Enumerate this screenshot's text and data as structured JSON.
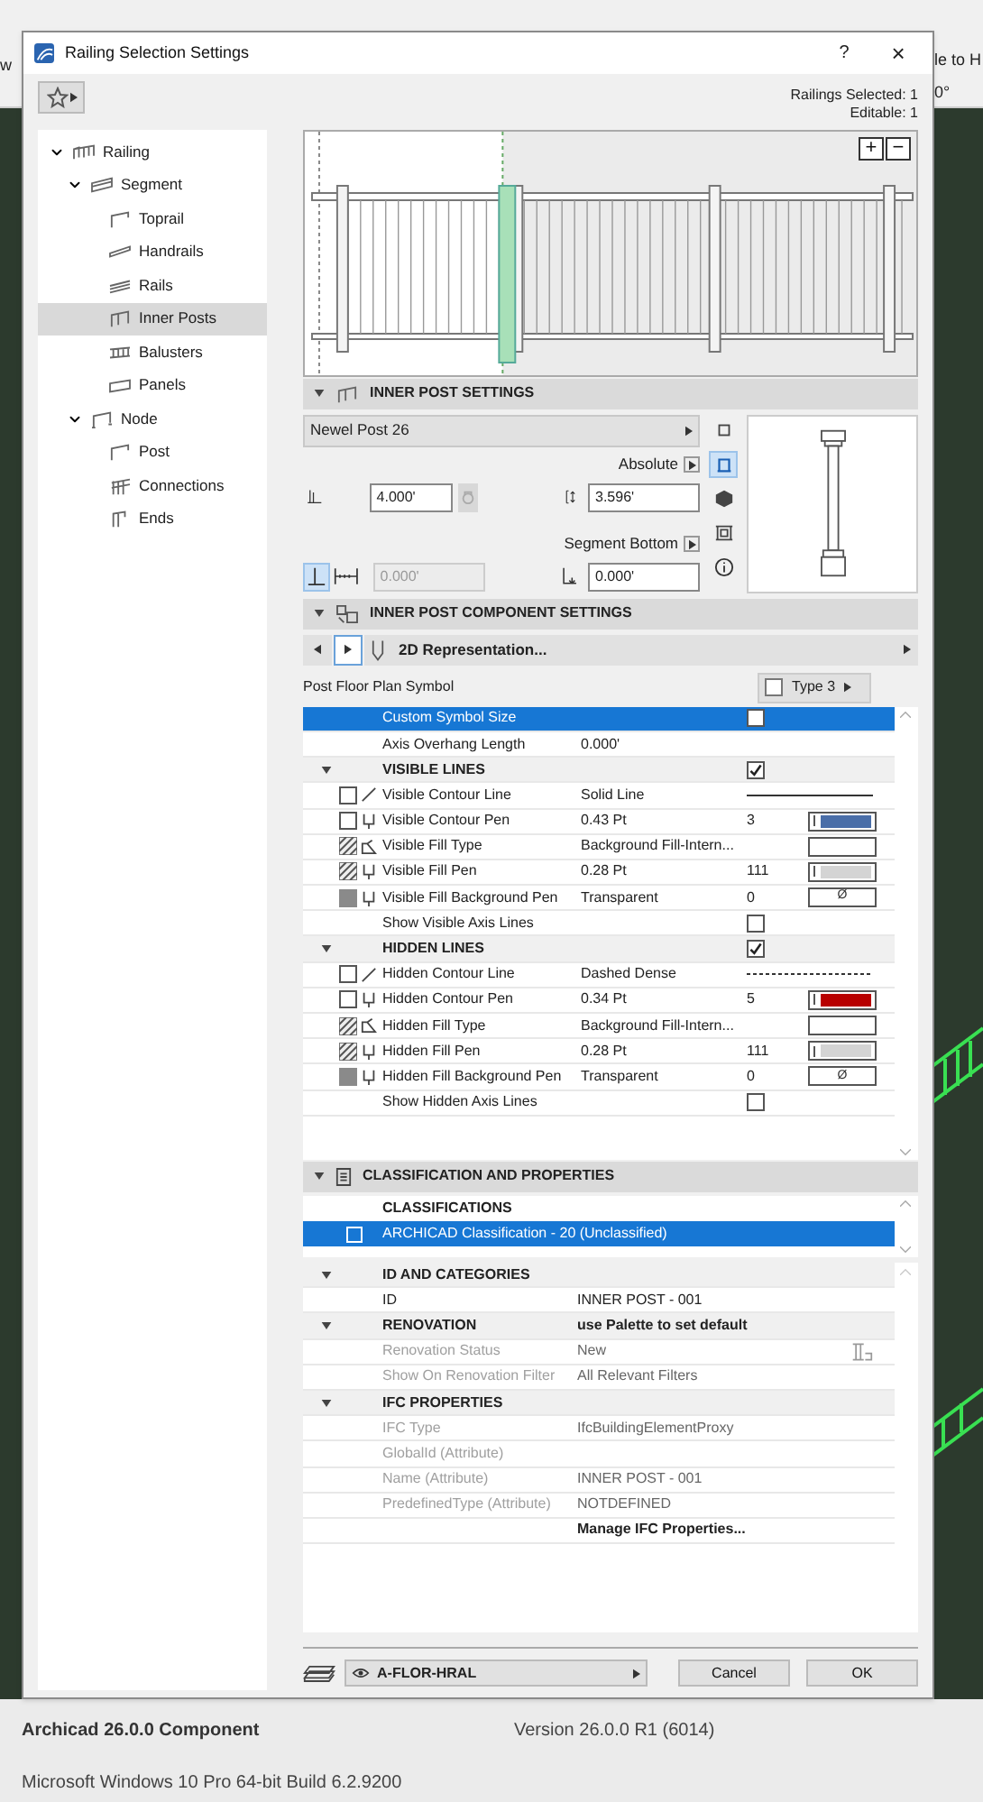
{
  "background": {
    "left_fragment": "w",
    "right_fragments": [
      "le to H",
      "0°"
    ]
  },
  "window": {
    "title": "Railing Selection Settings",
    "help": "?",
    "close": "×"
  },
  "selection_info": [
    "Railings Selected: 1",
    "Editable: 1"
  ],
  "tree": [
    {
      "label": "Railing",
      "kind": "railing",
      "expanded": true,
      "selected": false,
      "children": [
        {
          "label": "Segment",
          "kind": "segment",
          "expanded": true,
          "selected": false,
          "children": [
            {
              "label": "Toprail",
              "kind": "toprail",
              "selected": false
            },
            {
              "label": "Handrails",
              "kind": "handrail",
              "selected": false
            },
            {
              "label": "Rails",
              "kind": "rails",
              "selected": false
            },
            {
              "label": "Inner Posts",
              "kind": "posts",
              "selected": true
            },
            {
              "label": "Balusters",
              "kind": "balusters",
              "selected": false
            },
            {
              "label": "Panels",
              "kind": "panels",
              "selected": false
            }
          ]
        },
        {
          "label": "Node",
          "kind": "node",
          "expanded": true,
          "selected": false,
          "children": [
            {
              "label": "Post",
              "kind": "post",
              "selected": false
            },
            {
              "label": "Connections",
              "kind": "connections",
              "selected": false
            },
            {
              "label": "Ends",
              "kind": "ends",
              "selected": false
            }
          ]
        }
      ]
    }
  ],
  "preview": {
    "zoom_buttons": [
      "+",
      "−"
    ]
  },
  "inner_post_settings": {
    "title": "INNER POST SETTINGS",
    "post_type": "Newel Post 26",
    "height_mode": "Absolute",
    "height": "4.000'",
    "top_height": "3.596'",
    "offset_mode": "Segment Bottom",
    "offset_length": "0.000'",
    "offset": "0.000'",
    "view_buttons": [
      {
        "kind": "plan",
        "selected": false
      },
      {
        "kind": "section",
        "selected": true
      },
      {
        "kind": "model",
        "selected": false
      },
      {
        "kind": "frame",
        "selected": false
      },
      {
        "kind": "info",
        "selected": false
      }
    ]
  },
  "component_settings": {
    "title": "INNER POST COMPONENT SETTINGS",
    "page": "2D Representation...",
    "symbol_label": "Post Floor Plan Symbol",
    "symbol_type": "Type 3",
    "rows": [
      {
        "kind": "check",
        "label": "Custom Symbol Size",
        "checked": false,
        "selected": true
      },
      {
        "kind": "value",
        "label": "Axis Overhang Length",
        "value": "0.000'",
        "selected": false
      },
      {
        "kind": "group",
        "label": "VISIBLE LINES",
        "checked": true,
        "selected": false
      },
      {
        "kind": "line",
        "lead": {
          "kind": "checkbox",
          "checked": false
        },
        "label": "Visible Contour Line",
        "value": "Solid Line",
        "line": {
          "kind": "solid"
        },
        "selected": false
      },
      {
        "kind": "pen",
        "lead": {
          "kind": "checkbox",
          "checked": false
        },
        "label": "Visible Contour Pen",
        "value": "0.43 Pt",
        "number": "3",
        "color": "#4a6ea8",
        "selected": false
      },
      {
        "kind": "fill",
        "lead": {
          "kind": "hatch"
        },
        "label": "Visible Fill Type",
        "value": "Background Fill-Intern...",
        "selected": false
      },
      {
        "kind": "pen",
        "lead": {
          "kind": "hatch"
        },
        "label": "Visible Fill Pen",
        "value": "0.28 Pt",
        "number": "111",
        "color": "#d4d4d4",
        "selected": false
      },
      {
        "kind": "bgpen",
        "lead": {
          "kind": "square"
        },
        "label": "Visible Fill Background Pen",
        "value": "Transparent",
        "number": "0",
        "swatch": "Ø",
        "selected": false
      },
      {
        "kind": "check",
        "label": "Show Visible Axis Lines",
        "checked": false,
        "selected": false
      },
      {
        "kind": "group",
        "label": "HIDDEN LINES",
        "checked": true,
        "selected": false
      },
      {
        "kind": "line",
        "lead": {
          "kind": "checkbox",
          "checked": false
        },
        "label": "Hidden Contour Line",
        "value": "Dashed Dense",
        "line": {
          "kind": "dashed"
        },
        "selected": false
      },
      {
        "kind": "pen",
        "lead": {
          "kind": "checkbox",
          "checked": false
        },
        "label": "Hidden Contour Pen",
        "value": "0.34 Pt",
        "number": "5",
        "color": "#b80000",
        "selected": false
      },
      {
        "kind": "fill",
        "lead": {
          "kind": "hatch"
        },
        "label": "Hidden Fill Type",
        "value": "Background Fill-Intern...",
        "selected": false
      },
      {
        "kind": "pen",
        "lead": {
          "kind": "hatch"
        },
        "label": "Hidden Fill Pen",
        "value": "0.28 Pt",
        "number": "111",
        "color": "#d4d4d4",
        "selected": false
      },
      {
        "kind": "bgpen",
        "lead": {
          "kind": "square"
        },
        "label": "Hidden Fill Background Pen",
        "value": "Transparent",
        "number": "0",
        "swatch": "Ø",
        "selected": false
      },
      {
        "kind": "check",
        "label": "Show Hidden Axis Lines",
        "checked": false,
        "selected": false
      }
    ]
  },
  "classification": {
    "title": "CLASSIFICATION AND PROPERTIES",
    "heading": "CLASSIFICATIONS",
    "items": [
      {
        "label": "ARCHICAD Classification - 20 (Unclassified)",
        "selected": true
      }
    ]
  },
  "properties": [
    {
      "kind": "group",
      "label": "ID AND CATEGORIES"
    },
    {
      "kind": "prop",
      "label": "ID",
      "value": "INNER POST - 001",
      "disabled": false
    },
    {
      "kind": "group",
      "label": "RENOVATION",
      "value": "use Palette to set default"
    },
    {
      "kind": "prop_icon",
      "label": "Renovation Status",
      "value": "New",
      "disabled": true
    },
    {
      "kind": "prop",
      "label": "Show On Renovation Filter",
      "value": "All Relevant Filters",
      "disabled": true
    },
    {
      "kind": "group",
      "label": "IFC PROPERTIES"
    },
    {
      "kind": "prop",
      "label": "IFC Type",
      "value": "IfcBuildingElementProxy",
      "disabled": true
    },
    {
      "kind": "prop",
      "label": "GlobalId (Attribute)",
      "disabled": true
    },
    {
      "kind": "prop",
      "label": "Name (Attribute)",
      "value": "INNER POST - 001",
      "disabled": true
    },
    {
      "kind": "prop",
      "label": "PredefinedType (Attribute)",
      "value": "NOTDEFINED",
      "disabled": true
    },
    {
      "kind": "action",
      "label": "Manage IFC Properties..."
    }
  ],
  "footer": {
    "layer": "A-FLOR-HRAL",
    "buttons": [
      "Cancel",
      "OK"
    ]
  },
  "status": {
    "product": "Archicad 26.0.0 Component",
    "version": "Version 26.0.0 R1 (6014)",
    "os": "Microsoft Windows 10 Pro 64-bit Build 6.2.9200"
  }
}
